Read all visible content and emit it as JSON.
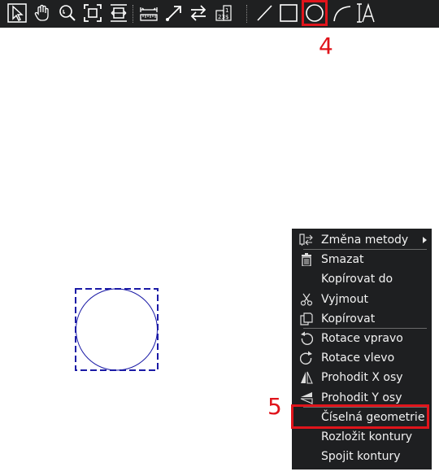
{
  "toolbar": {
    "tools": [
      {
        "icon": "select-cursor-icon"
      },
      {
        "icon": "pan-hand-icon"
      },
      {
        "icon": "zoom-icon"
      },
      {
        "icon": "zoom-extents-icon"
      },
      {
        "icon": "zoom-width-icon"
      },
      {
        "icon": "measure-icon"
      },
      {
        "icon": "move-arrow-icon"
      },
      {
        "icon": "swap-icon"
      },
      {
        "icon": "numbers-icon"
      },
      {
        "icon": "line-icon"
      },
      {
        "icon": "rectangle-icon"
      },
      {
        "icon": "circle-icon"
      },
      {
        "icon": "arc-icon"
      },
      {
        "icon": "text-icon"
      }
    ],
    "highlighted_tool": "circle-icon"
  },
  "annotations": {
    "step_4": "4",
    "step_5": "5",
    "color": "#e0141b"
  },
  "context_menu": {
    "items": [
      {
        "label": "Změna metody",
        "icon": "change-method-icon",
        "has_submenu": true
      },
      {
        "label": "Smazat",
        "icon": "trash-icon"
      },
      {
        "label": "Kopírovat do",
        "icon": ""
      },
      {
        "label": "Vyjmout",
        "icon": "scissors-icon"
      },
      {
        "label": "Kopírovat",
        "icon": "copy-icon"
      },
      {
        "label": "Rotace vpravo",
        "icon": "rotate-right-icon"
      },
      {
        "label": "Rotace vlevo",
        "icon": "rotate-left-icon"
      },
      {
        "label": "Prohodit X osy",
        "icon": "flip-x-icon"
      },
      {
        "label": "Prohodit Y osy",
        "icon": "flip-y-icon"
      },
      {
        "label": "Číselná geometrie",
        "icon": ""
      },
      {
        "label": "Rozložit kontury",
        "icon": ""
      },
      {
        "label": "Spojit kontury",
        "icon": ""
      }
    ],
    "highlighted_item": "Číselná geometrie"
  },
  "colors": {
    "toolbar_bg": "#1f2021",
    "menu_bg": "#1e1f21",
    "selection_blue": "#1a1aa6"
  }
}
